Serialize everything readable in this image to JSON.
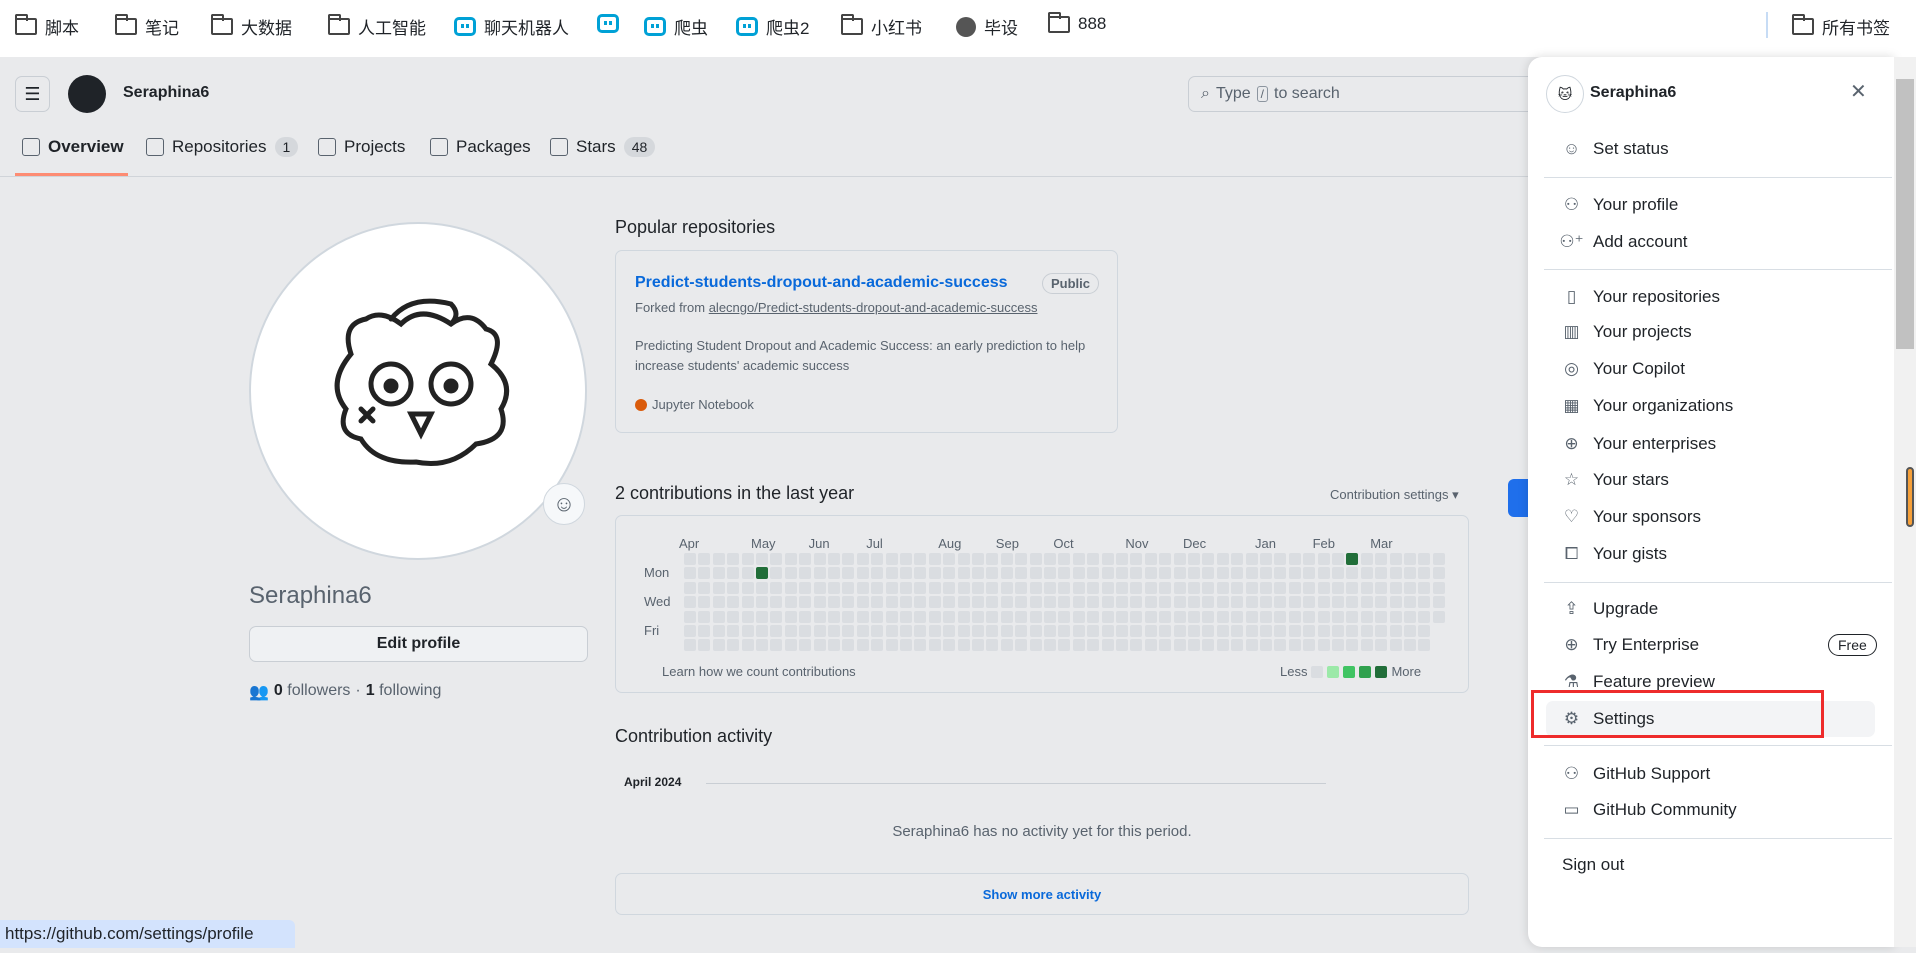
{
  "bookmarks": [
    {
      "label": "脚本",
      "icon": "folder-icon"
    },
    {
      "label": "笔记",
      "icon": "folder-icon"
    },
    {
      "label": "大数据",
      "icon": "folder-icon"
    },
    {
      "label": "人工智能",
      "icon": "folder-icon"
    },
    {
      "label": "聊天机器人",
      "icon": "bilibili-icon"
    },
    {
      "label": "",
      "icon": "bilibili-icon"
    },
    {
      "label": "爬虫",
      "icon": "bilibili-icon"
    },
    {
      "label": "爬虫2",
      "icon": "bilibili-icon"
    },
    {
      "label": "小红书",
      "icon": "folder-icon"
    },
    {
      "label": "毕设",
      "icon": "globe-icon"
    },
    {
      "label": "888",
      "icon": "folder-icon"
    }
  ],
  "all_bookmarks": "所有书签",
  "header": {
    "username": "Seraphina6",
    "search_placeholder_pre": "Type",
    "search_key": "/",
    "search_placeholder_post": "to search"
  },
  "tabs": [
    {
      "label": "Overview"
    },
    {
      "label": "Repositories",
      "count": "1"
    },
    {
      "label": "Projects"
    },
    {
      "label": "Packages"
    },
    {
      "label": "Stars",
      "count": "48"
    }
  ],
  "profile": {
    "name": "Seraphina6",
    "edit_label": "Edit profile",
    "followers": "0",
    "followers_label": "followers",
    "following": "1",
    "following_label": "following"
  },
  "popular": {
    "title": "Popular repositories",
    "repo": {
      "name": "Predict-students-dropout-and-academic-success",
      "visibility": "Public",
      "forked_prefix": "Forked from",
      "forked_from": "alecngo/Predict-students-dropout-and-academic-success",
      "description": "Predicting Student Dropout and Academic Success: an early prediction to help increase students' academic success",
      "language": "Jupyter Notebook",
      "language_color": "#DA5B0B"
    }
  },
  "contrib": {
    "title": "2 contributions in the last year",
    "settings": "Contribution settings",
    "weeks": 53,
    "last_week_days": 5,
    "months": [
      {
        "label": "Apr",
        "week": 0
      },
      {
        "label": "May",
        "week": 5
      },
      {
        "label": "Jun",
        "week": 9
      },
      {
        "label": "Jul",
        "week": 13
      },
      {
        "label": "Aug",
        "week": 18
      },
      {
        "label": "Sep",
        "week": 22
      },
      {
        "label": "Oct",
        "week": 26
      },
      {
        "label": "Nov",
        "week": 31
      },
      {
        "label": "Dec",
        "week": 35
      },
      {
        "label": "Jan",
        "week": 40
      },
      {
        "label": "Feb",
        "week": 44
      },
      {
        "label": "Mar",
        "week": 48
      }
    ],
    "days": [
      "Mon",
      "Wed",
      "Fri"
    ],
    "active": [
      {
        "week": 5,
        "day": 1,
        "level": 4
      },
      {
        "week": 46,
        "day": 0,
        "level": 4
      }
    ],
    "levels": [
      "#dadde1",
      "#9be9a8",
      "#40c463",
      "#30a14e",
      "#216e39"
    ],
    "learn": "Learn how we count contributions",
    "less": "Less",
    "more": "More"
  },
  "activity": {
    "title": "Contribution activity",
    "month": "April 2024",
    "empty": "Seraphina6 has no activity yet for this period.",
    "show_more": "Show more activity"
  },
  "status_url": "https://github.com/settings/profile",
  "menu": {
    "username": "Seraphina6",
    "items": [
      {
        "label": "Set status",
        "icon": "smiley-icon"
      },
      {
        "label": "Your profile",
        "icon": "person-icon"
      },
      {
        "label": "Add account",
        "icon": "person-add-icon"
      },
      {
        "label": "Your repositories",
        "icon": "repo-icon"
      },
      {
        "label": "Your projects",
        "icon": "project-icon"
      },
      {
        "label": "Your Copilot",
        "icon": "copilot-icon"
      },
      {
        "label": "Your organizations",
        "icon": "organization-icon"
      },
      {
        "label": "Your enterprises",
        "icon": "globe-icon"
      },
      {
        "label": "Your stars",
        "icon": "star-icon"
      },
      {
        "label": "Your sponsors",
        "icon": "heart-icon"
      },
      {
        "label": "Your gists",
        "icon": "code-square-icon"
      },
      {
        "label": "Upgrade",
        "icon": "upload-icon"
      },
      {
        "label": "Try Enterprise",
        "icon": "globe-icon",
        "badge": "Free"
      },
      {
        "label": "Feature preview",
        "icon": "beaker-icon"
      },
      {
        "label": "Settings",
        "icon": "gear-icon"
      },
      {
        "label": "GitHub Support",
        "icon": "people-icon"
      },
      {
        "label": "GitHub Community",
        "icon": "comment-discussion-icon"
      },
      {
        "label": "Sign out"
      }
    ]
  }
}
